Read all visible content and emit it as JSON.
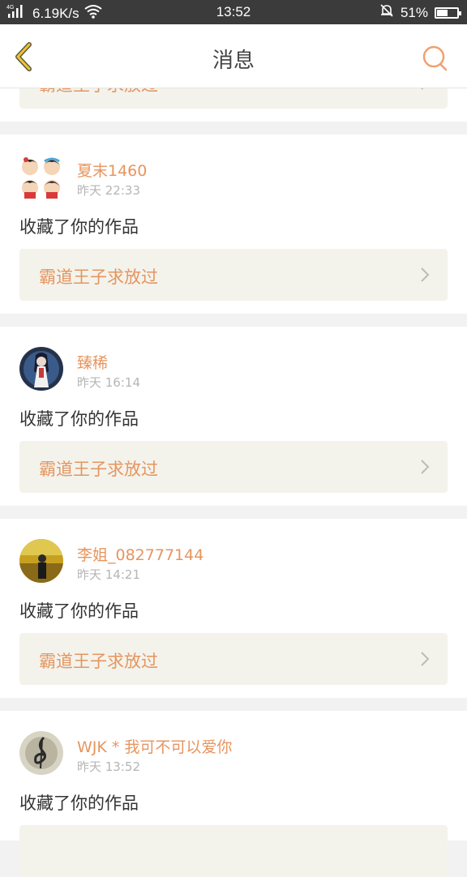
{
  "status_bar": {
    "network": "4G",
    "speed": "6.19K/s",
    "time": "13:52",
    "battery": "51%",
    "battery_level": 0.51
  },
  "header": {
    "title": "消息",
    "back_icon": "chevron-left-icon",
    "search_icon": "search-icon",
    "accent_color": "#e6955f"
  },
  "partial_top": {
    "work_title": "霸道王子求放过"
  },
  "messages": [
    {
      "username": "夏末1460",
      "time": "昨天 22:33",
      "action": "收藏了你的作品",
      "work_title": "霸道王子求放过"
    },
    {
      "username": "臻稀",
      "time": "昨天 16:14",
      "action": "收藏了你的作品",
      "work_title": "霸道王子求放过"
    },
    {
      "username": "李姐_082777144",
      "time": "昨天 14:21",
      "action": "收藏了你的作品",
      "work_title": "霸道王子求放过"
    },
    {
      "username": "WJK * 我可不可以爱你",
      "time": "昨天 13:52",
      "action": "收藏了你的作品",
      "work_title": ""
    }
  ]
}
